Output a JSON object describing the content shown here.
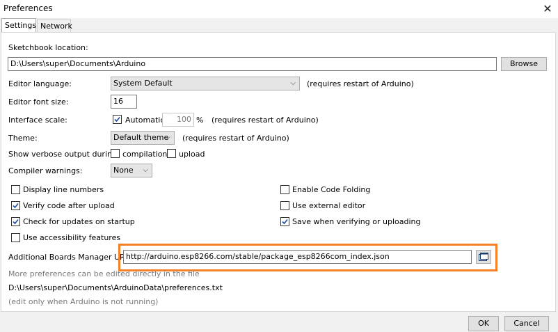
{
  "window": {
    "title": "Preferences"
  },
  "tabs": [
    {
      "label": "Settings"
    },
    {
      "label": "Network"
    }
  ],
  "sketchbook": {
    "label": "Sketchbook location:",
    "value": "D:\\Users\\super\\Documents\\Arduino",
    "browse": "Browse"
  },
  "editor_language": {
    "label": "Editor language:",
    "value": "System Default",
    "note": "(requires restart of Arduino)"
  },
  "font_size": {
    "label": "Editor font size:",
    "value": "16"
  },
  "interface_scale": {
    "label": "Interface scale:",
    "automatic": "Automatic",
    "automatic_checked": true,
    "value": "100",
    "percent": "%",
    "note": "(requires restart of Arduino)"
  },
  "theme": {
    "label": "Theme:",
    "value": "Default theme",
    "note": "(requires restart of Arduino)"
  },
  "verbose": {
    "label": "Show verbose output during:",
    "compilation": "compilation",
    "compilation_checked": false,
    "upload": "upload",
    "upload_checked": false
  },
  "compiler_warnings": {
    "label": "Compiler warnings:",
    "value": "None"
  },
  "options_left": [
    {
      "label": "Display line numbers",
      "checked": false
    },
    {
      "label": "Verify code after upload",
      "checked": true
    },
    {
      "label": "Check for updates on startup",
      "checked": true
    },
    {
      "label": "Use accessibility features",
      "checked": false
    }
  ],
  "options_right": [
    {
      "label": "Enable Code Folding",
      "checked": false
    },
    {
      "label": "Use external editor",
      "checked": false
    },
    {
      "label": "Save when verifying or uploading",
      "checked": true
    }
  ],
  "boards_manager": {
    "label": "Additional Boards Manager URLs:",
    "value": "http://arduino.esp8266.com/stable/package_esp8266com_index.json",
    "button_icon": "window-list-icon"
  },
  "more_prefs": {
    "line1": "More preferences can be edited directly in the file",
    "path": "D:\\Users\\super\\Documents\\ArduinoData\\preferences.txt",
    "note": "(edit only when Arduino is not running)"
  },
  "buttons": {
    "ok": "OK",
    "cancel": "Cancel"
  },
  "colors": {
    "highlight": "#f58025",
    "check": "#1a4a9e"
  }
}
